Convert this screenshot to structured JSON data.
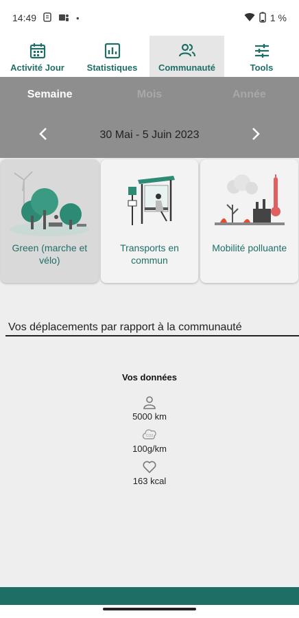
{
  "status_bar": {
    "time": "14:49",
    "battery": "1 %",
    "icons": [
      "sim-icon",
      "teams-icon",
      "dot-icon",
      "wifi-icon",
      "battery-icon"
    ]
  },
  "nav": {
    "tabs": [
      {
        "label": "Activité Jour",
        "icon": "calendar-icon"
      },
      {
        "label": "Statistiques",
        "icon": "chart-icon"
      },
      {
        "label": "Communauté",
        "icon": "people-icon",
        "active": true
      },
      {
        "label": "Tools",
        "icon": "sliders-icon"
      }
    ]
  },
  "period": {
    "tabs": [
      {
        "label": "Semaine",
        "active": true
      },
      {
        "label": "Mois"
      },
      {
        "label": "Année"
      }
    ],
    "date_range": "30 Mai - 5 Juin 2023"
  },
  "cards": [
    {
      "label": "Green (marche et vélo)",
      "selected": true
    },
    {
      "label": "Transports en commun"
    },
    {
      "label": "Mobilité polluante"
    }
  ],
  "section": {
    "title": "Vos déplacements par rapport à la communauté"
  },
  "data": {
    "title": "Vos données",
    "items": [
      {
        "icon": "person-icon",
        "value": "5000 km"
      },
      {
        "icon": "co2-cloud-icon",
        "value": "100g/km"
      },
      {
        "icon": "heart-icon",
        "value": "163 kcal"
      }
    ]
  },
  "colors": {
    "accent": "#1f6e66",
    "period_bg": "#8e8e8e",
    "background": "#eeeeee"
  }
}
